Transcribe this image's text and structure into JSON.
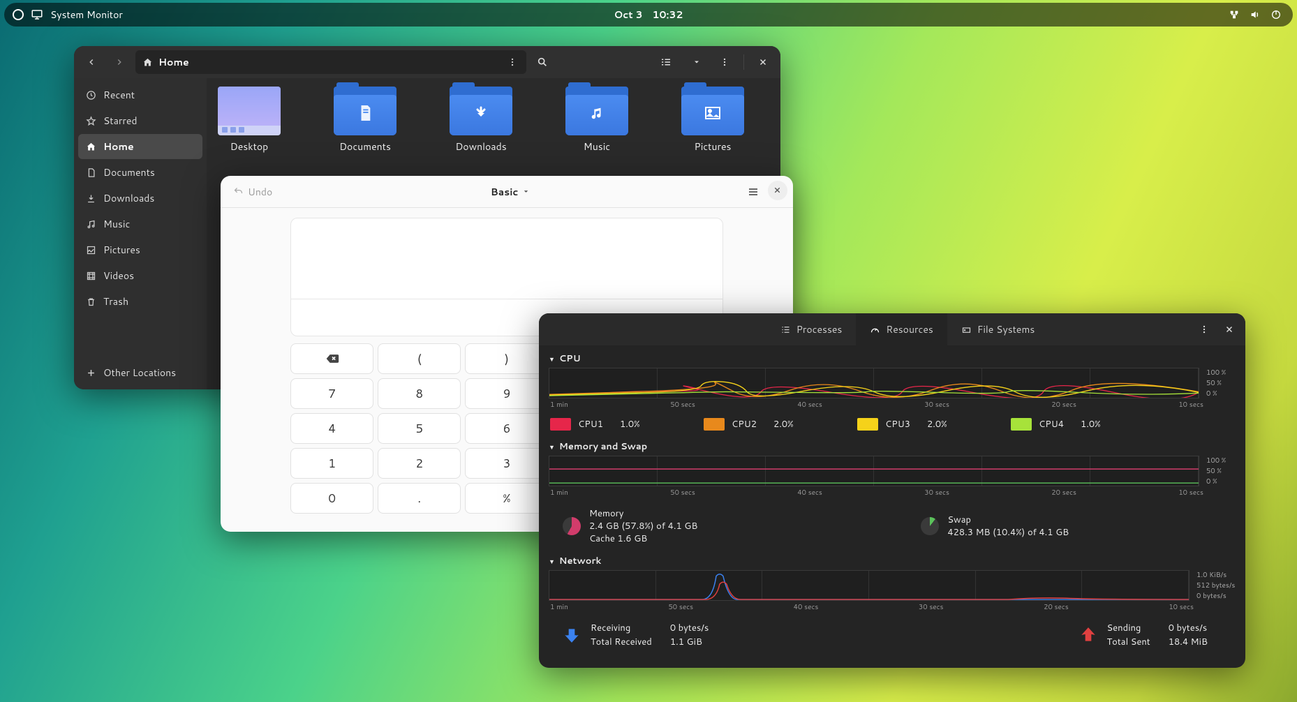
{
  "topbar": {
    "app_label": "System Monitor",
    "date": "Oct 3",
    "time": "10:32"
  },
  "files": {
    "path_label": "Home",
    "sidebar": [
      {
        "label": "Recent"
      },
      {
        "label": "Starred"
      },
      {
        "label": "Home"
      },
      {
        "label": "Documents"
      },
      {
        "label": "Downloads"
      },
      {
        "label": "Music"
      },
      {
        "label": "Pictures"
      },
      {
        "label": "Videos"
      },
      {
        "label": "Trash"
      }
    ],
    "other_locations": "Other Locations",
    "folders": [
      {
        "label": "Desktop"
      },
      {
        "label": "Documents"
      },
      {
        "label": "Downloads"
      },
      {
        "label": "Music"
      },
      {
        "label": "Pictures"
      }
    ]
  },
  "calc": {
    "undo": "Undo",
    "mode": "Basic",
    "keys": [
      "⌫",
      "(",
      ")",
      "",
      "",
      "7",
      "8",
      "9",
      "",
      "",
      "4",
      "5",
      "6",
      "",
      "",
      "1",
      "2",
      "3",
      "",
      "",
      "0",
      ".",
      "%",
      "",
      ""
    ]
  },
  "sysmon": {
    "tabs": {
      "processes": "Processes",
      "resources": "Resources",
      "filesystems": "File Systems"
    },
    "sections": {
      "cpu": "CPU",
      "mem": "Memory and Swap",
      "net": "Network"
    },
    "yaxis_pct": [
      "100 %",
      "50 %",
      "0 %"
    ],
    "yaxis_net": [
      "1.0 KiB/s",
      "512 bytes/s",
      "0 bytes/s"
    ],
    "xaxis": [
      "1 min",
      "50 secs",
      "40 secs",
      "30 secs",
      "20 secs",
      "10 secs"
    ],
    "cpu": [
      {
        "name": "CPU1",
        "val": "1.0%",
        "color": "#e6264a"
      },
      {
        "name": "CPU2",
        "val": "2.0%",
        "color": "#e8891c"
      },
      {
        "name": "CPU3",
        "val": "2.0%",
        "color": "#f5d21a"
      },
      {
        "name": "CPU4",
        "val": "1.0%",
        "color": "#a7e23a"
      }
    ],
    "memory": {
      "title": "Memory",
      "line1": "2.4 GB (57.8%) of 4.1 GB",
      "line2": "Cache 1.6 GB",
      "swap_title": "Swap",
      "swap_line": "428.3 MB (10.4%) of 4.1 GB"
    },
    "network": {
      "recv_title": "Receiving",
      "recv_rate": "0 bytes/s",
      "recv_total_l": "Total Received",
      "recv_total_v": "1.1 GiB",
      "send_title": "Sending",
      "send_rate": "0 bytes/s",
      "send_total_l": "Total Sent",
      "send_total_v": "18.4 MiB"
    }
  }
}
